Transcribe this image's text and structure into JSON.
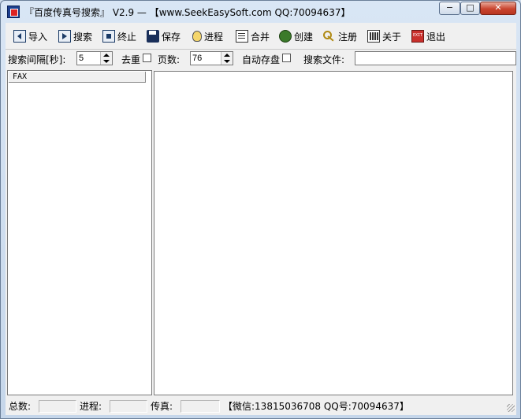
{
  "window": {
    "title": "『百度传真号搜索』 V2.9 — 【www.SeekEasySoft.com QQ:70094637】",
    "min_label": "−",
    "max_label": "□",
    "close_label": "✕"
  },
  "toolbar": {
    "import_label": "导入",
    "search_label": "搜索",
    "stop_label": "终止",
    "save_label": "保存",
    "progress_label": "进程",
    "merge_label": "合并",
    "create_label": "创建",
    "register_label": "注册",
    "about_label": "关于",
    "exit_label": "退出"
  },
  "options": {
    "interval_label": "搜索间隔[秒]:",
    "interval_value": "5",
    "dedupe_label": "去重",
    "pages_label": "页数:",
    "pages_value": "76",
    "autosave_label": "自动存盘",
    "search_file_label": "搜索文件:",
    "search_file_value": ""
  },
  "results": {
    "column_header": "FAX"
  },
  "status": {
    "total_label": "总数:",
    "total_value": "",
    "progress_label": "进程:",
    "progress_value": "",
    "fax_label": "传真:",
    "fax_value": "",
    "contact": "【微信:13815036708 QQ号:70094637】"
  }
}
